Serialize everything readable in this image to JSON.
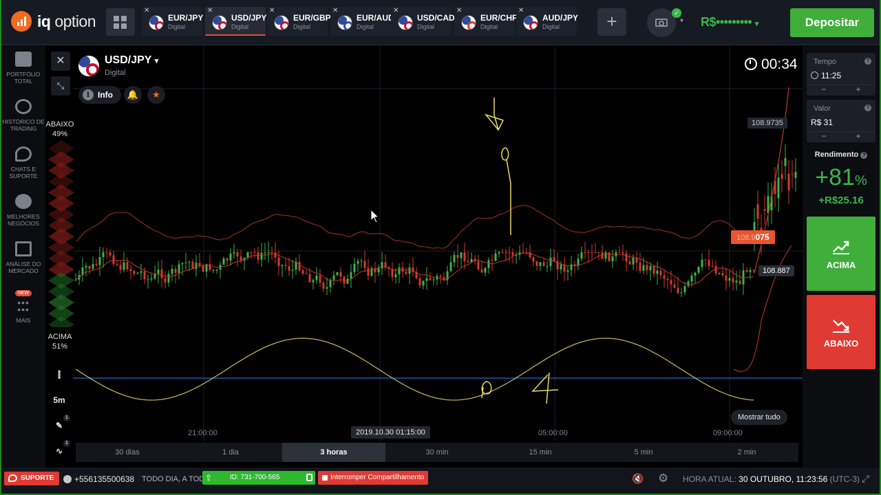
{
  "brand": {
    "name_bold": "iq",
    "name_rest": "option"
  },
  "tabs": [
    {
      "pair": "EUR/JPY",
      "type": "Digital",
      "active": false,
      "flag_a": "#2e4c9a",
      "flag_b": "#c8102e"
    },
    {
      "pair": "USD/JPY",
      "type": "Digital",
      "active": true,
      "flag_a": "#2e4c9a",
      "flag_b": "#c8102e"
    },
    {
      "pair": "EUR/GBP",
      "type": "Digital",
      "active": false,
      "flag_a": "#2e4c9a",
      "flag_b": "#c8102e"
    },
    {
      "pair": "EUR/AUD",
      "type": "Digital",
      "active": false,
      "flag_a": "#2e4c9a",
      "flag_b": "#2e4c9a"
    },
    {
      "pair": "USD/CAD",
      "type": "Digital",
      "active": false,
      "flag_a": "#2e4c9a",
      "flag_b": "#c8102e"
    },
    {
      "pair": "EUR/CHF",
      "type": "Digital",
      "active": false,
      "flag_a": "#2e4c9a",
      "flag_b": "#e03b33"
    },
    {
      "pair": "AUD/JPY",
      "type": "Digital",
      "active": false,
      "flag_a": "#2e4c9a",
      "flag_b": "#c8102e"
    }
  ],
  "topbar": {
    "add_tab": "+",
    "balance": "R$•••••••••",
    "balance_caret": "▾",
    "camera_caret": "▾",
    "camera_check": "✓",
    "deposit_label": "Depositar"
  },
  "sidebar": [
    {
      "icon": "briefcase-icon",
      "label_1": "PORTFÓLIO",
      "label_2": "TOTAL"
    },
    {
      "icon": "history-clock-icon",
      "label_1": "HISTÓRICO DE",
      "label_2": "TRADING"
    },
    {
      "icon": "chat-icon",
      "label_1": "CHATS E",
      "label_2": "SUPORTE"
    },
    {
      "icon": "medal-icon",
      "label_1": "MELHORES",
      "label_2": "NEGÓCIOS"
    },
    {
      "icon": "news-icon",
      "label_1": "ANÁLISE DO",
      "label_2": "MERCADO"
    },
    {
      "icon": "more-dots-icon",
      "badge": "NEW",
      "label_1": "MAIS",
      "label_2": ""
    }
  ],
  "chart": {
    "close_glyph": "✕",
    "collapse_glyph": "⤡",
    "asset_name": "USD/JPY",
    "asset_caret": "▾",
    "asset_type": "Digital",
    "info_label": "Info",
    "info_glyph": "i",
    "bell_glyph": "🔔",
    "star_glyph": "★",
    "timer": "00:34",
    "abaixo_label": "ABAIXO",
    "abaixo_pct": "49%",
    "acima_label": "ACIMA",
    "acima_pct": "51%",
    "price_upper": "108.9735",
    "price_current_prefix": "108.9",
    "price_current_suffix": "075",
    "price_strike": "108.887",
    "time_labels": [
      "21:00:00",
      "05:00:00",
      "09:00:00"
    ],
    "cursor_date": "2019.10.30 01:15:00",
    "mostrar_tudo": "Mostrar tudo",
    "tool_candles_glyph": "⫿",
    "tool_interval": "5m",
    "tool_draw_glyph": "✎",
    "tool_indicator_glyph": "∿",
    "tool_badge": "1",
    "timeframes": [
      {
        "label": "30 dias",
        "active": false
      },
      {
        "label": "1 dia",
        "active": false
      },
      {
        "label": "3 horas",
        "active": true
      },
      {
        "label": "30 min",
        "active": false
      },
      {
        "label": "15 min",
        "active": false
      },
      {
        "label": "5 min",
        "active": false
      },
      {
        "label": "2 min",
        "active": false
      }
    ],
    "colors": {
      "up": "#3cb54a",
      "down": "#d43a2f",
      "band": "#c0392b",
      "ma": "#e0d060",
      "strike": "#2e64c8"
    }
  },
  "right": {
    "tempo_label": "Tempo",
    "tempo_value": "11:25",
    "valor_label": "Valor",
    "valor_value": "R$ 31",
    "minus": "−",
    "plus": "+",
    "help": "?",
    "rendimento_label": "Rendimento",
    "rendimento_pct": "+81",
    "rendimento_pct_sign": "%",
    "rendimento_gain": "+R$25.16",
    "acima_label": "ACIMA",
    "abaixo_label": "ABAIXO"
  },
  "bottom": {
    "suporte": "SUPORTE",
    "phone": "+556135500638",
    "all_day": "TODO DIA, A TODA HORA",
    "share_id": "ID: 731-700-565",
    "stop_share": "Interromper Compartilhamento",
    "clock_label": "HORA ATUAL:",
    "clock_value": "30 OUTUBRO, 11:23:56",
    "clock_tz": "(UTC-3)"
  }
}
